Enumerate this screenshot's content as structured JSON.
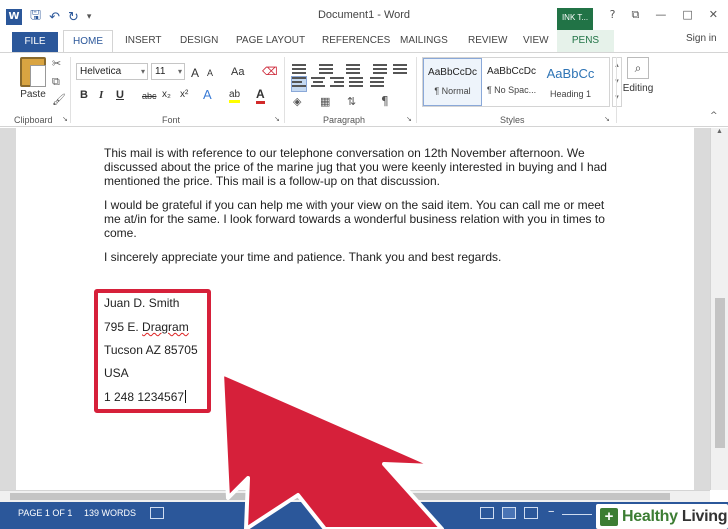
{
  "window": {
    "title": "Document1 - Word",
    "context_tab_group": "INK T...",
    "sign_in": "Sign in",
    "controls": [
      "?",
      "⧉",
      "—",
      "□",
      "✕"
    ]
  },
  "quick_access": {
    "app_icon": "word-logo-icon",
    "icons": [
      "save-icon",
      "undo-icon",
      "redo-icon",
      "customize-icon"
    ]
  },
  "tabs": {
    "file": "FILE",
    "home": "HOME",
    "insert": "INSERT",
    "design": "DESIGN",
    "page_layout": "PAGE LAYOUT",
    "references": "REFERENCES",
    "mailings": "MAILINGS",
    "review": "REVIEW",
    "view": "VIEW",
    "pens": "PENS"
  },
  "ribbon": {
    "clipboard": {
      "label": "Clipboard",
      "paste": "Paste"
    },
    "font": {
      "label": "Font",
      "family": "Helvetica",
      "size": "11",
      "grow": "A",
      "shrink": "A",
      "case": "Aa",
      "bold": "B",
      "italic": "I",
      "underline": "U",
      "strike": "abc",
      "subscript": "x₂",
      "superscript": "x²",
      "effects": "A",
      "highlight": "ab",
      "color": "A",
      "highlight_color": "#ffff00",
      "font_color": "#d22a2a"
    },
    "paragraph": {
      "label": "Paragraph",
      "pilcrow": "¶"
    },
    "styles": {
      "label": "Styles",
      "items": [
        {
          "preview": "AaBbCcDc",
          "name": "¶ Normal"
        },
        {
          "preview": "AaBbCcDc",
          "name": "¶ No Spac..."
        },
        {
          "preview": "AaBbCc",
          "name": "Heading 1"
        }
      ]
    },
    "editing": {
      "label": "Editing"
    }
  },
  "document": {
    "paragraphs": [
      [
        "This mail is with reference to our telephone conversation on 12th November afternoon. We",
        "discussed about the price of the marine jug that you were keenly interested in buying and I had",
        "mentioned the price. This mail is a follow-up on that discussion."
      ],
      [
        "I would be grateful if you can help me with your view on the said item. You can call me or meet",
        "me at/in for the same. I look forward towards a wonderful business relation with you in times to",
        "come."
      ],
      [
        "I sincerely appreciate your time and patience. Thank you and best regards."
      ]
    ],
    "address": {
      "name": "Juan D. Smith",
      "street_number": "795 E.",
      "street_name": "Dragram",
      "city": "Tucson AZ 85705",
      "country": "USA",
      "phone": "1 248 1234567"
    }
  },
  "status": {
    "page": "PAGE 1 OF 1",
    "words": "139 WORDS",
    "accent_color": "#2b579a"
  },
  "watermark": {
    "part1": "Healthy",
    "part2": "Living",
    "icon": "plus-icon"
  },
  "annotation": {
    "box_color": "#d6203a",
    "arrow_color": "#d6203a"
  }
}
